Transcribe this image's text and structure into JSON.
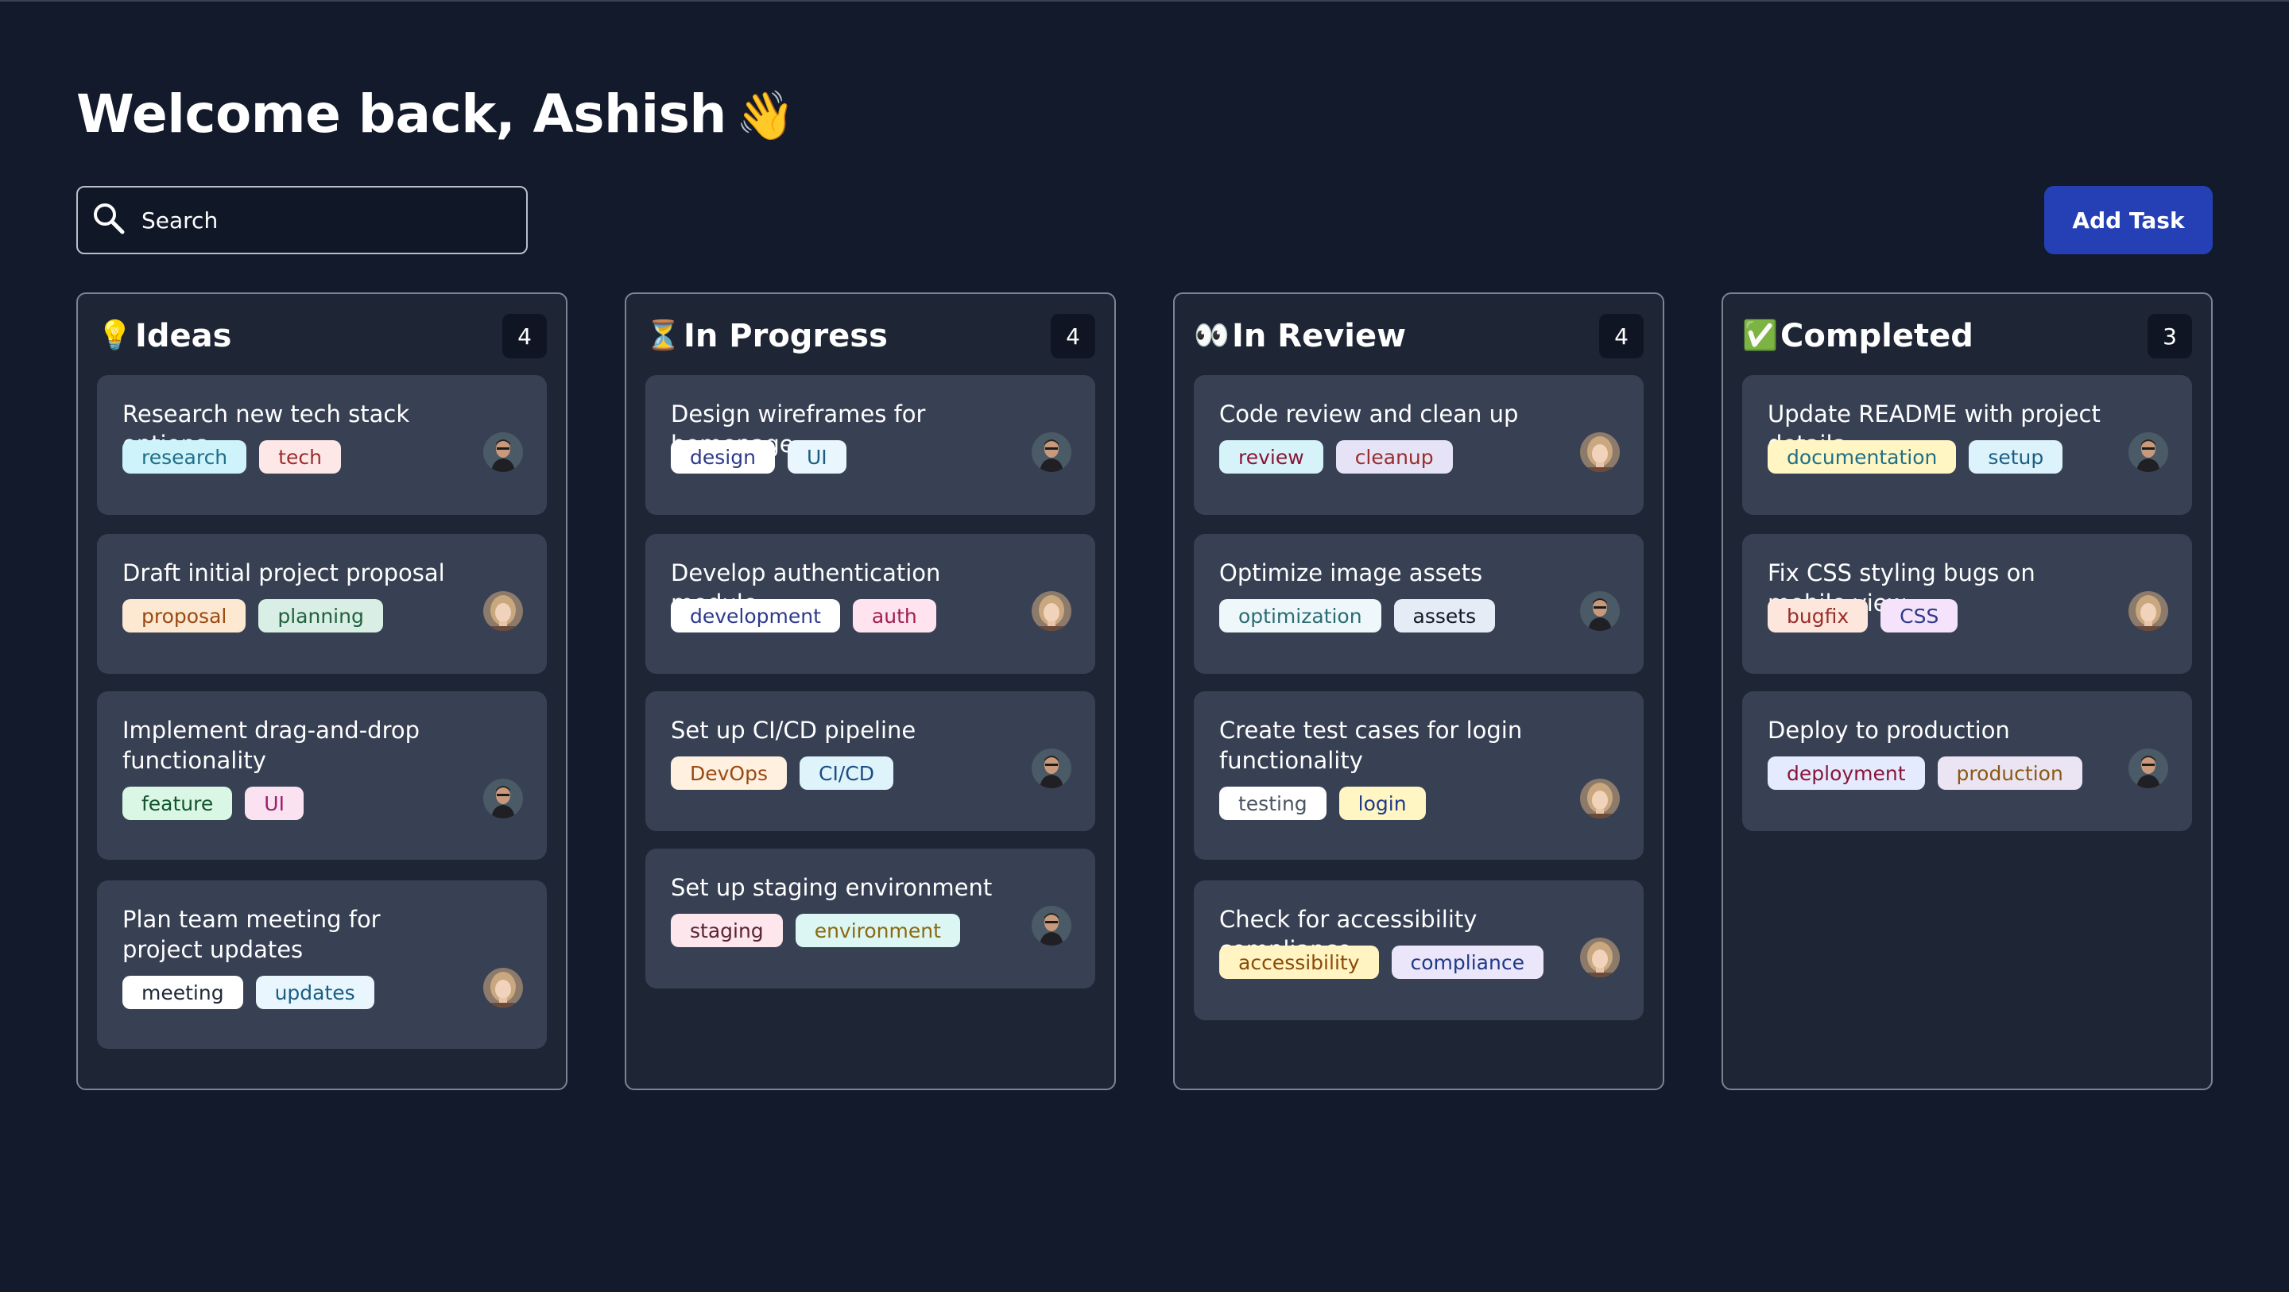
{
  "header": {
    "title": "Welcome back, Ashish",
    "wave": "👋"
  },
  "search": {
    "placeholder": "Search",
    "icon": "search-icon"
  },
  "add_task_label": "Add Task",
  "colors": {
    "background": "#121a2b",
    "column": "#1e2535",
    "card": "#384154",
    "accent": "#2540b5"
  },
  "columns": [
    {
      "icon": "💡",
      "icon_name": "lightbulb-icon",
      "title": "Ideas",
      "count": "4",
      "cards": [
        {
          "title": "Research new tech stack options",
          "tags": [
            {
              "label": "research",
              "bg": "#cff3fb",
              "fg": "#1f6f86"
            },
            {
              "label": "tech",
              "bg": "#fde7e7",
              "fg": "#9b2c2c"
            }
          ],
          "avatar": "man"
        },
        {
          "title": "Draft initial project proposal",
          "tags": [
            {
              "label": "proposal",
              "bg": "#fde8d2",
              "fg": "#9a4a12"
            },
            {
              "label": "planning",
              "bg": "#d9eee4",
              "fg": "#216140"
            }
          ],
          "avatar": "woman"
        },
        {
          "title": "Implement drag-and-drop functionality",
          "tags": [
            {
              "label": "feature",
              "bg": "#d9f7e4",
              "fg": "#14532d"
            },
            {
              "label": "UI",
              "bg": "#fbe2f1",
              "fg": "#9d1f6b"
            }
          ],
          "avatar": "man"
        },
        {
          "title": "Plan team meeting for project updates",
          "tags": [
            {
              "label": "meeting",
              "bg": "#ffffff",
              "fg": "#1f2937"
            },
            {
              "label": "updates",
              "bg": "#e9f6fd",
              "fg": "#1a5e84"
            }
          ],
          "avatar": "woman"
        }
      ]
    },
    {
      "icon": "⏳",
      "icon_name": "hourglass-icon",
      "title": "In Progress",
      "count": "4",
      "cards": [
        {
          "title": "Design wireframes for homepage",
          "tags": [
            {
              "label": "design",
              "bg": "#ffffff",
              "fg": "#2d3a8c"
            },
            {
              "label": "UI",
              "bg": "#e9f6fd",
              "fg": "#1a5e84"
            }
          ],
          "avatar": "man"
        },
        {
          "title": "Develop authentication module",
          "tags": [
            {
              "label": "development",
              "bg": "#ffffff",
              "fg": "#2d3a8c"
            },
            {
              "label": "auth",
              "bg": "#ffe4ef",
              "fg": "#9d1f4f"
            }
          ],
          "avatar": "woman"
        },
        {
          "title": "Set up CI/CD pipeline",
          "tags": [
            {
              "label": "DevOps",
              "bg": "#fff0e0",
              "fg": "#9a4a12"
            },
            {
              "label": "CI/CD",
              "bg": "#dff3fb",
              "fg": "#1a4e84"
            }
          ],
          "avatar": "man"
        },
        {
          "title": "Set up staging environment",
          "tags": [
            {
              "label": "staging",
              "bg": "#fde6ec",
              "fg": "#5b2333"
            },
            {
              "label": "environment",
              "bg": "#dcf6f4",
              "fg": "#8a6a11"
            }
          ],
          "avatar": "man"
        }
      ]
    },
    {
      "icon": "👀",
      "icon_name": "eyes-icon",
      "title": "In Review",
      "count": "4",
      "cards": [
        {
          "title": "Code review and clean up",
          "tags": [
            {
              "label": "review",
              "bg": "#d6f3fa",
              "fg": "#8a1538"
            },
            {
              "label": "cleanup",
              "bg": "#e6e3f7",
              "fg": "#9b2c2c"
            }
          ],
          "avatar": "woman"
        },
        {
          "title": "Optimize image assets",
          "tags": [
            {
              "label": "optimization",
              "bg": "#eef8fb",
              "fg": "#2c6b73"
            },
            {
              "label": "assets",
              "bg": "#e5ecf5",
              "fg": "#111827"
            }
          ],
          "avatar": "man"
        },
        {
          "title": "Create test cases for login functionality",
          "tags": [
            {
              "label": "testing",
              "bg": "#ffffff",
              "fg": "#4b5563"
            },
            {
              "label": "login",
              "bg": "#fff6c4",
              "fg": "#1e3a8a"
            }
          ],
          "avatar": "woman"
        },
        {
          "title": "Check for accessibility compliance",
          "tags": [
            {
              "label": "accessibility",
              "bg": "#fff4c2",
              "fg": "#8a4b08"
            },
            {
              "label": "compliance",
              "bg": "#ebe6fa",
              "fg": "#1e3a8a"
            }
          ],
          "avatar": "woman"
        }
      ]
    },
    {
      "icon": "✅",
      "icon_name": "check-mark-icon",
      "title": "Completed",
      "count": "3",
      "cards": [
        {
          "title": "Update README with project details",
          "tags": [
            {
              "label": "documentation",
              "bg": "#fff6c4",
              "fg": "#1f6f86"
            },
            {
              "label": "setup",
              "bg": "#ddf3fb",
              "fg": "#1a5e84"
            }
          ],
          "avatar": "man"
        },
        {
          "title": "Fix CSS styling bugs on mobile view",
          "tags": [
            {
              "label": "bugfix",
              "bg": "#fde7dc",
              "fg": "#9b2c2c"
            },
            {
              "label": "CSS",
              "bg": "#f5e3fb",
              "fg": "#2d3a8c"
            }
          ],
          "avatar": "woman"
        },
        {
          "title": "Deploy to production",
          "tags": [
            {
              "label": "deployment",
              "bg": "#e5ebff",
              "fg": "#8a1538"
            },
            {
              "label": "production",
              "bg": "#ebe4f2",
              "fg": "#8a5a12"
            }
          ],
          "avatar": "man"
        }
      ]
    }
  ]
}
